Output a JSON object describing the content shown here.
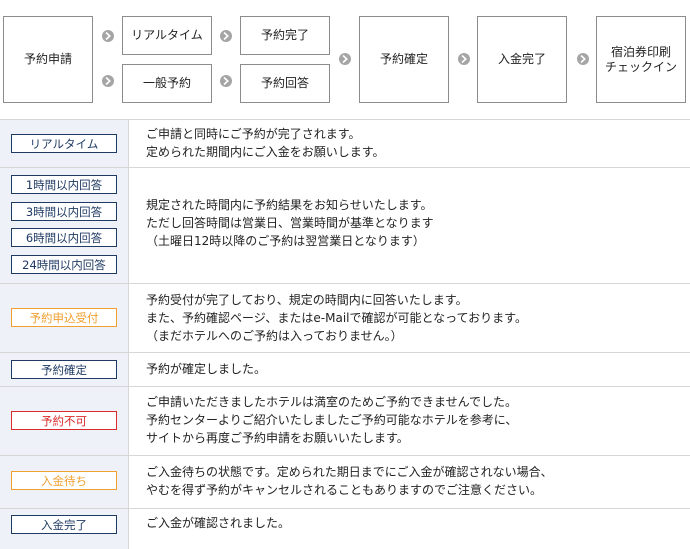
{
  "colors": {
    "navy": "#1f3a63",
    "orange": "#f0a030",
    "red": "#d92b2b",
    "label_bg": "#eef2f8",
    "border": "#8c8c8c"
  },
  "flow": {
    "apply": "予約申請",
    "realtime": "リアルタイム",
    "general": "一般予約",
    "completed": "予約完了",
    "answer": "予約回答",
    "confirmed": "予約確定",
    "paid": "入金完了",
    "checkin_line1": "宿泊券印刷",
    "checkin_line2": "チェックイン",
    "arrow_icon": "chevron-right-icon"
  },
  "statuses": [
    {
      "badges": [
        "リアルタイム"
      ],
      "lines": [
        "ご申請と同時にご予約が完了されます。",
        "定められた期間内にご入金をお願いします。"
      ]
    },
    {
      "badges": [
        "1時間以内回答",
        "3時間以内回答",
        "6時間以内回答",
        "24時間以内回答"
      ],
      "lines": [
        "規定された時間内に予約結果をお知らせいたします。",
        "ただし回答時間は営業日、営業時間が基準となります",
        "（土曜日12時以降のご予約は翌営業日となります）"
      ]
    },
    {
      "badges": [
        "予約申込受付"
      ],
      "lines": [
        "予約受付が完了しており、規定の時間内に回答いたします。",
        "また、予約確認ページ、またはe-Mailで確認が可能となっております。",
        "（まだホテルへのご予約は入っておりません。）"
      ]
    },
    {
      "badges": [
        "予約確定"
      ],
      "lines": [
        "予約が確定しました。"
      ]
    },
    {
      "badges": [
        "予約不可"
      ],
      "lines": [
        "ご申請いただきましたホテルは満室のためご予約できませんでした。",
        "予約センターよりご紹介いたしましたご予約可能なホテルを参考に、",
        "サイトから再度ご予約申請をお願いいたします。"
      ]
    },
    {
      "badges": [
        "入金待ち"
      ],
      "lines": [
        "ご入金待ちの状態です。定められた期日までにご入金が確認されない場合、",
        "やむを得ず予約がキャンセルされることもありますのでご注意ください。"
      ]
    },
    {
      "badges": [
        "入金完了"
      ],
      "lines": [
        "ご入金が確認されました。"
      ]
    }
  ]
}
